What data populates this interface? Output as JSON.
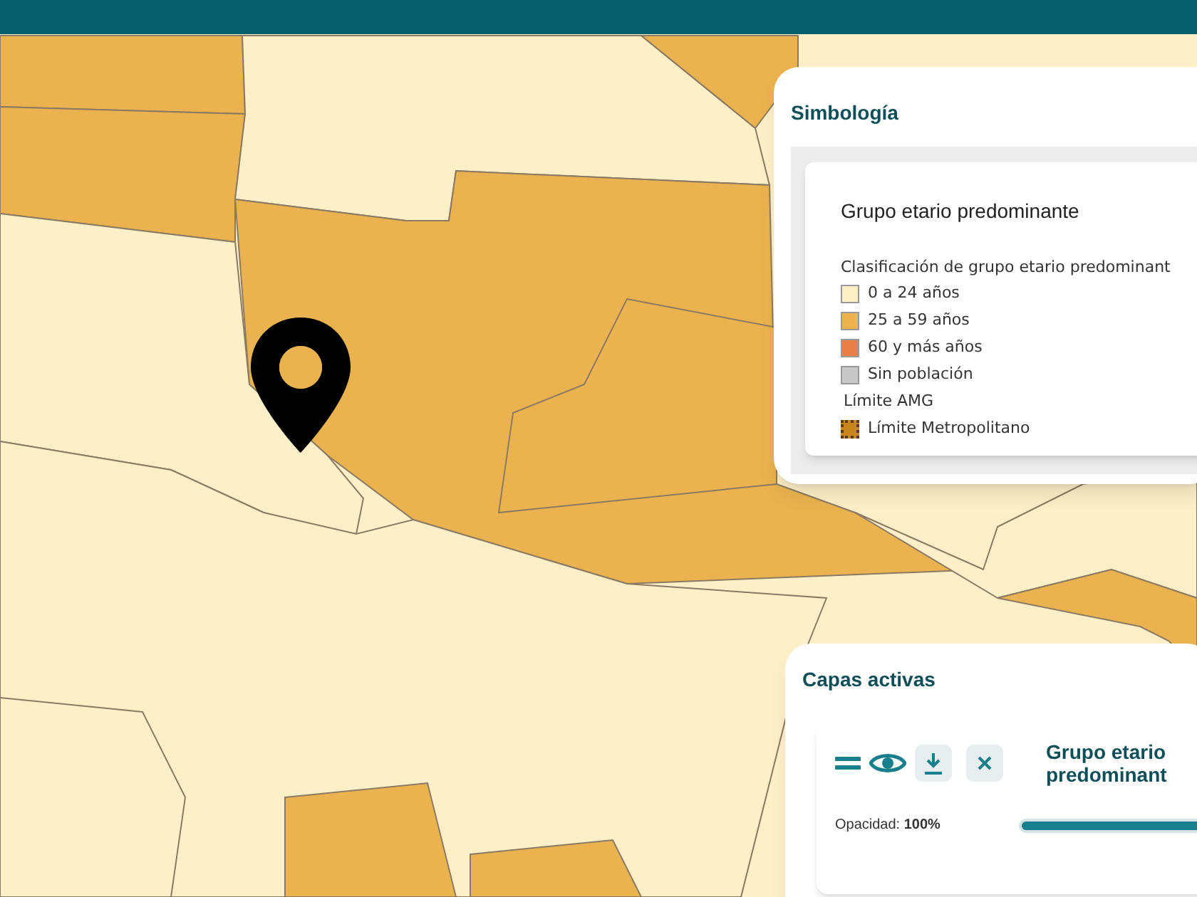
{
  "legend": {
    "title": "Simbología",
    "layer_title": "Grupo etario predominante",
    "subtitle": "Clasificación de grupo etario predominant",
    "items": [
      {
        "kind": "swatch",
        "label": "0 a 24 años",
        "color": "#fcefc6"
      },
      {
        "kind": "swatch",
        "label": "25 a 59 años",
        "color": "#ecb34e"
      },
      {
        "kind": "swatch",
        "label": "60 y más años",
        "color": "#e9804a"
      },
      {
        "kind": "swatch",
        "label": "Sin población",
        "color": "#c8c8c8"
      },
      {
        "kind": "heading",
        "label": "Límite AMG"
      },
      {
        "kind": "pattern",
        "label": "Límite Metropolitano",
        "color": "#c9861c"
      }
    ]
  },
  "active_layers": {
    "title": "Capas activas",
    "layers": [
      {
        "name": "Grupo etario predominant",
        "visible": true,
        "opacity_label": "Opacidad:",
        "opacity_value": "100%",
        "level": 1
      }
    ]
  }
}
